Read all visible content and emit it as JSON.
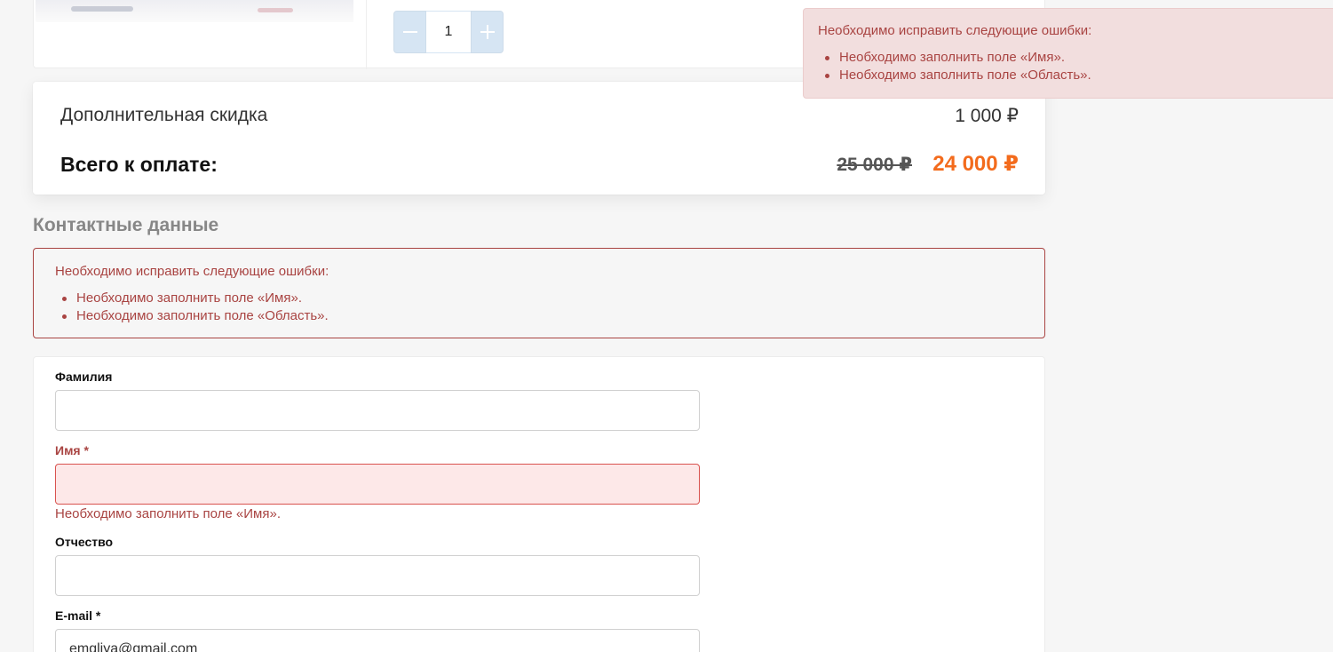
{
  "cart_item": {
    "quantity": "1",
    "minus_icon": "minus-icon",
    "plus_icon": "plus-icon"
  },
  "summary": {
    "discount_label": "Дополнительная скидка",
    "discount_value": "1 000 ₽",
    "total_label": "Всего к оплате:",
    "old_price": "25 000 ₽",
    "new_price": "24 000 ₽"
  },
  "contacts": {
    "title": "Контактные данные",
    "error_summary": {
      "header": "Необходимо исправить следующие ошибки:",
      "items": [
        "Необходимо заполнить поле «Имя».",
        "Необходимо заполнить поле «Область»."
      ]
    },
    "fields": {
      "last_name": {
        "label": "Фамилия",
        "value": ""
      },
      "first_name": {
        "label": "Имя *",
        "value": "",
        "error": "Необходимо заполнить поле «Имя»."
      },
      "middle_name": {
        "label": "Отчество",
        "value": ""
      },
      "email": {
        "label": "E-mail *",
        "value": "emgliya@gmail.com"
      }
    }
  },
  "toast": {
    "header": "Необходимо исправить следующие ошибки:",
    "items": [
      "Необходимо заполнить поле «Имя».",
      "Необходимо заполнить поле «Область»."
    ]
  },
  "colors": {
    "accent_price": "#f36b1c",
    "error": "#a94442",
    "error_bg": "#f2dede",
    "qty_button": "#d6e5f3"
  }
}
